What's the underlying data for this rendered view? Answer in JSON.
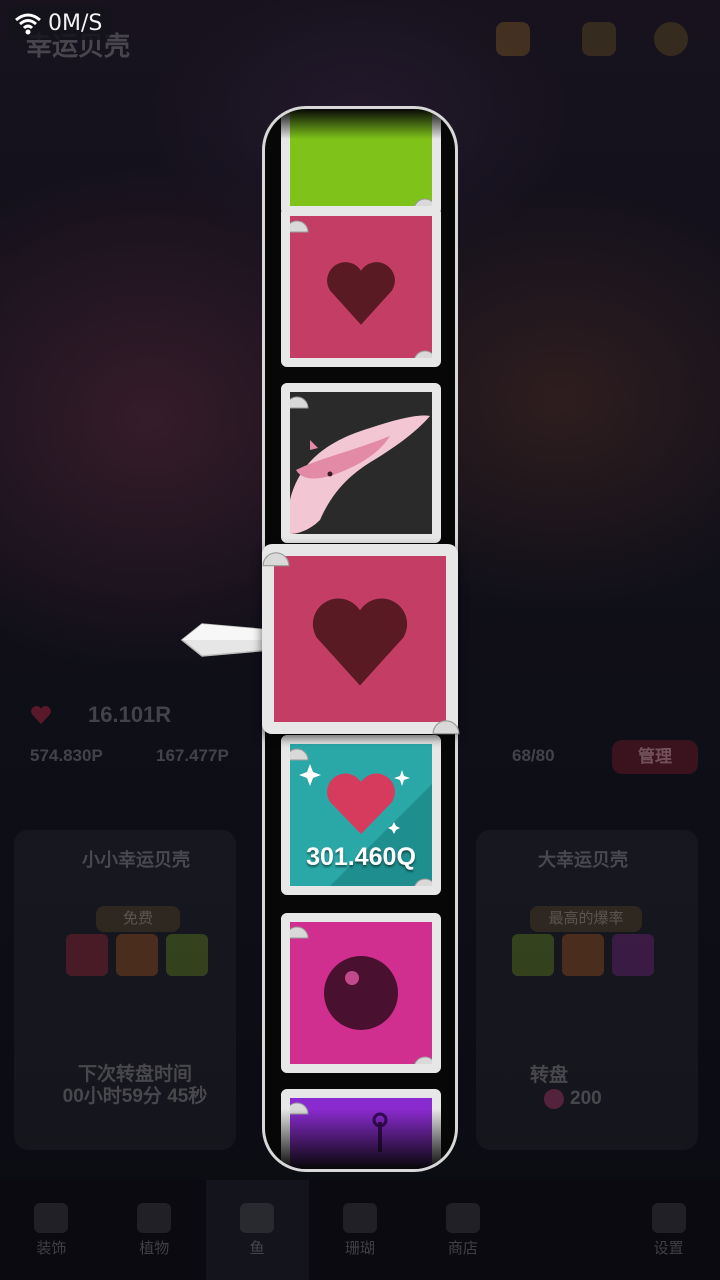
{
  "status_bar": {
    "network_speed": "0M/S",
    "wifi_icon": "wifi-icon"
  },
  "header": {
    "title": "幸运贝壳"
  },
  "currency": {
    "main_value": "16.101R",
    "secondary": "574.830P",
    "secondary2": "167.477P",
    "capacity": "68/80",
    "manage_label": "管理"
  },
  "left_panel": {
    "title": "小小幸运贝壳",
    "badge": "免费",
    "next_spin_label": "下次转盘时间",
    "next_spin_time": "00小时59分 45秒"
  },
  "right_panel": {
    "title": "大幸运贝壳",
    "badge": "最高的爆率",
    "spin_label": "转盘",
    "spin_cost": "200"
  },
  "bottom_nav": {
    "items": [
      {
        "label": "装饰",
        "icon": "shell-icon"
      },
      {
        "label": "植物",
        "icon": "plant-icon"
      },
      {
        "label": "鱼",
        "icon": "fish-icon"
      },
      {
        "label": "珊瑚",
        "icon": "coral-icon"
      },
      {
        "label": "商店",
        "icon": "cart-icon"
      },
      {
        "label": "",
        "icon": "blank-icon"
      },
      {
        "label": "设置",
        "icon": "gear-icon"
      }
    ],
    "active_index": 2
  },
  "slot_reel": {
    "tiles": [
      {
        "type": "color",
        "color": "#7ec21a",
        "icon": "green-block"
      },
      {
        "type": "heart",
        "color": "#c43d65",
        "icon": "heart-icon"
      },
      {
        "type": "whale",
        "color": "#2a2a2a",
        "icon": "pink-whale-icon"
      },
      {
        "type": "heart-bonus",
        "color": "#2aa8a8",
        "icon": "sparkle-heart-icon",
        "label": "301.460Q"
      },
      {
        "type": "pearl",
        "color": "#d12f8f",
        "icon": "pearl-icon"
      },
      {
        "type": "plant",
        "color": "#8a2bd0",
        "icon": "purple-plant-icon"
      }
    ],
    "selected": {
      "type": "heart",
      "color": "#c43d65",
      "icon": "heart-icon"
    },
    "pointer_icon": "arrow-pointer-icon"
  },
  "colors": {
    "heart_dark": "#5a1a24",
    "frame": "#e7e7e7",
    "heart_bright": "#d63a5c"
  }
}
